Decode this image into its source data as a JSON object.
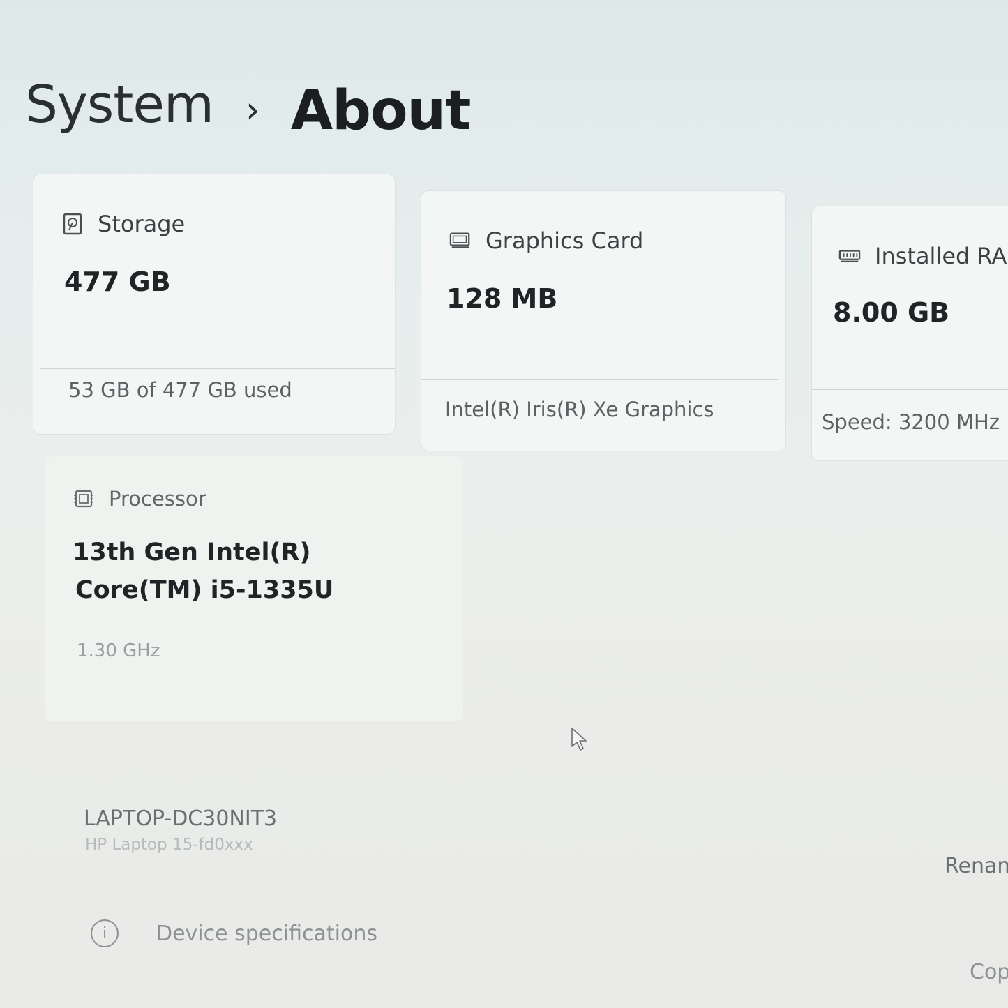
{
  "breadcrumb": {
    "parent": "System",
    "separator": "›",
    "current": "About"
  },
  "specs": {
    "storage": {
      "icon": "storage-drive-icon",
      "label": "Storage",
      "value": "477 GB",
      "detail": "53 GB of 477 GB used"
    },
    "graphics": {
      "icon": "graphics-card-icon",
      "label": "Graphics Card",
      "value": "128 MB",
      "detail": "Intel(R) Iris(R) Xe Graphics"
    },
    "ram": {
      "icon": "memory-module-icon",
      "label": "Installed RAM",
      "value": "8.00 GB",
      "detail": "Speed: 3200 MHz"
    },
    "processor": {
      "icon": "processor-chip-icon",
      "label": "Processor",
      "value_line1": "13th Gen Intel(R)",
      "value_line2": "Core(TM) i5-1335U",
      "detail": "1.30 GHz"
    }
  },
  "device": {
    "name": "LAPTOP-DC30NIT3",
    "model": "HP Laptop 15-fd0xxx",
    "rename_label": "Renam"
  },
  "device_specifications": {
    "label": "Device specifications",
    "copy_label": "Cop"
  },
  "colors": {
    "background": "#e6eeed",
    "card": "#f6f8f7",
    "text_primary": "#202426",
    "text_secondary": "#5b6264"
  }
}
